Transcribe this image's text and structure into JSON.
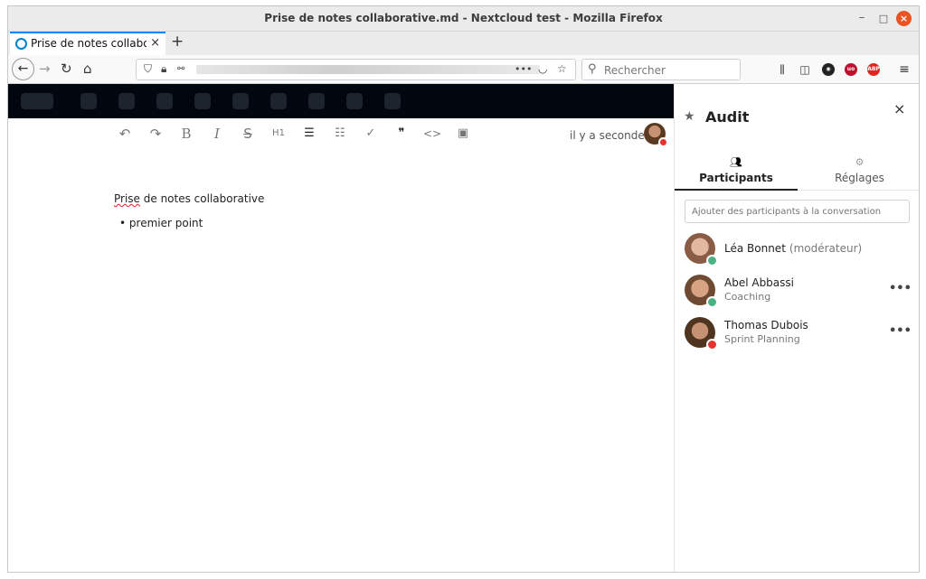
{
  "window": {
    "title": "Prise de notes collaborative.md - Nextcloud test - Mozilla Firefox",
    "controls": [
      "–",
      "□",
      "×"
    ]
  },
  "browser": {
    "tab_label": "Prise de notes collaborative.md - Nextcloud test",
    "tab_close": "×",
    "new_tab": "+",
    "search_placeholder": "Rechercher",
    "url_actions": "•••"
  },
  "editor": {
    "last_saved": "il y a secondes",
    "toolbar": [
      {
        "icon": "undo-icon",
        "glyph": "↶"
      },
      {
        "icon": "redo-icon",
        "glyph": "↷"
      },
      {
        "icon": "bold-icon",
        "glyph": "B"
      },
      {
        "icon": "italic-icon",
        "glyph": "I"
      },
      {
        "icon": "strikethrough-icon",
        "glyph": "S"
      },
      {
        "icon": "heading-icon",
        "glyph": "H1"
      },
      {
        "icon": "bullet-list-icon",
        "glyph": "☰"
      },
      {
        "icon": "ordered-list-icon",
        "glyph": "☷"
      },
      {
        "icon": "checkbox-icon",
        "glyph": "✓"
      },
      {
        "icon": "blockquote-icon",
        "glyph": "❞"
      },
      {
        "icon": "code-icon",
        "glyph": "<>"
      },
      {
        "icon": "image-icon",
        "glyph": "▣"
      }
    ],
    "document": {
      "title_word": "Prise",
      "title_rest": " de notes collaborative",
      "bullet": "premier point"
    }
  },
  "sidebar": {
    "title": "Audit",
    "close": "×",
    "tabs": [
      {
        "label": "Participants",
        "active": true
      },
      {
        "label": "Réglages",
        "active": false
      }
    ],
    "search_placeholder": "Ajouter des participants à la conversation",
    "participants": [
      {
        "name": "Léa Bonnet",
        "role": "(modérateur)",
        "subtitle": "",
        "status": "online",
        "status_color": "#49b382",
        "more": ""
      },
      {
        "name": "Abel Abbassi",
        "role": "",
        "subtitle": "Coaching",
        "status": "online",
        "status_color": "#49b382",
        "more": "•••"
      },
      {
        "name": "Thomas Dubois",
        "role": "",
        "subtitle": "Sprint Planning",
        "status": "dnd",
        "status_color": "#e9322d",
        "more": "•••"
      }
    ]
  }
}
